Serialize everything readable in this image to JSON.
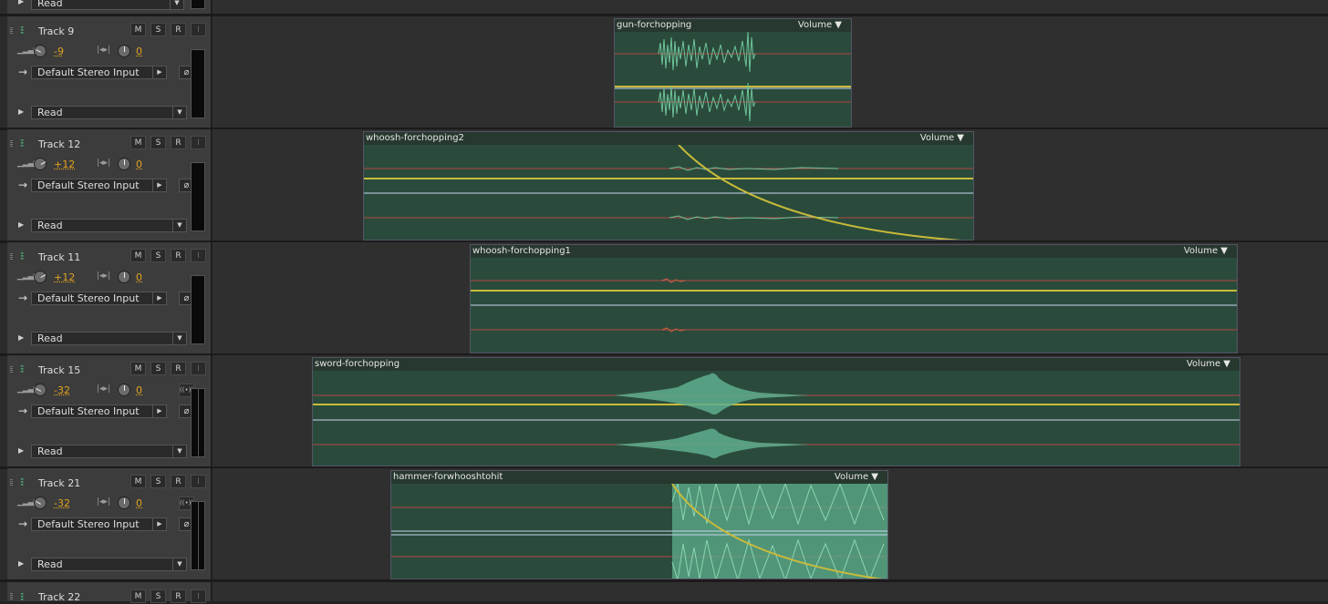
{
  "top_partial": {
    "mode": "Read"
  },
  "tracks": [
    {
      "name": "Track 9",
      "volume": "-9",
      "pan": "0",
      "input": "Default Stereo Input",
      "mode": "Read",
      "clip": {
        "name": "gun-forchopping",
        "envelope_label": "Volume"
      }
    },
    {
      "name": "Track 12",
      "volume": "+12",
      "pan": "0",
      "input": "Default Stereo Input",
      "mode": "Read",
      "clip": {
        "name": "whoosh-forchopping2",
        "envelope_label": "Volume"
      }
    },
    {
      "name": "Track 11",
      "volume": "+12",
      "pan": "0",
      "input": "Default Stereo Input",
      "mode": "Read",
      "clip": {
        "name": "whoosh-forchopping1",
        "envelope_label": "Volume"
      }
    },
    {
      "name": "Track 15",
      "volume": "-32",
      "pan": "0",
      "input": "Default Stereo Input",
      "mode": "Read",
      "clip": {
        "name": "sword-forchopping",
        "envelope_label": "Volume"
      }
    },
    {
      "name": "Track 21",
      "volume": "-32",
      "pan": "0",
      "input": "Default Stereo Input",
      "mode": "Read",
      "clip": {
        "name": "hammer-forwhooshtohit",
        "envelope_label": "Volume"
      }
    },
    {
      "name": "Track 22"
    }
  ],
  "buttons": {
    "mute": "M",
    "solo": "S",
    "record": "R",
    "input": "I"
  },
  "colors": {
    "waveform": "#5fae8e",
    "clip_bg": "#2a4b3c",
    "envelope": "#c9bb3a",
    "value": "#e2a41e",
    "track_icon": "#4fd18a"
  }
}
